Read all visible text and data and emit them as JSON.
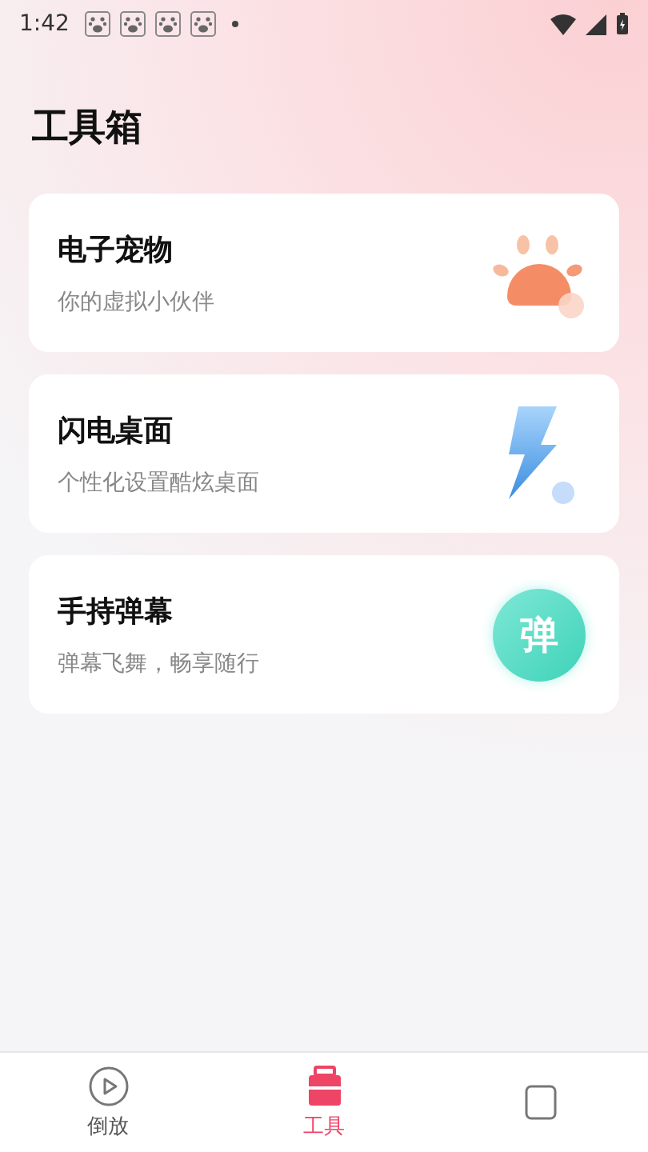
{
  "status_bar": {
    "time": "1:42",
    "notifications": [
      {
        "kind": "paw"
      },
      {
        "kind": "paw"
      },
      {
        "kind": "paw"
      },
      {
        "kind": "paw"
      },
      {
        "kind": "dot"
      }
    ]
  },
  "page_title": "工具箱",
  "tools": [
    {
      "kind": "pet",
      "title": "电子宠物",
      "subtitle": "你的虚拟小伙伴"
    },
    {
      "kind": "lightning",
      "title": "闪电桌面",
      "subtitle": "个性化设置酷炫桌面"
    },
    {
      "kind": "bullet",
      "title": "手持弹幕",
      "subtitle": "弹幕飞舞，畅享随行",
      "icon_text": "弹"
    }
  ],
  "bottom_nav": [
    {
      "kind": "play",
      "label": "倒放",
      "selected": false
    },
    {
      "kind": "toolbox",
      "label": "工具",
      "selected": true
    },
    {
      "kind": "other",
      "selected": false
    }
  ]
}
